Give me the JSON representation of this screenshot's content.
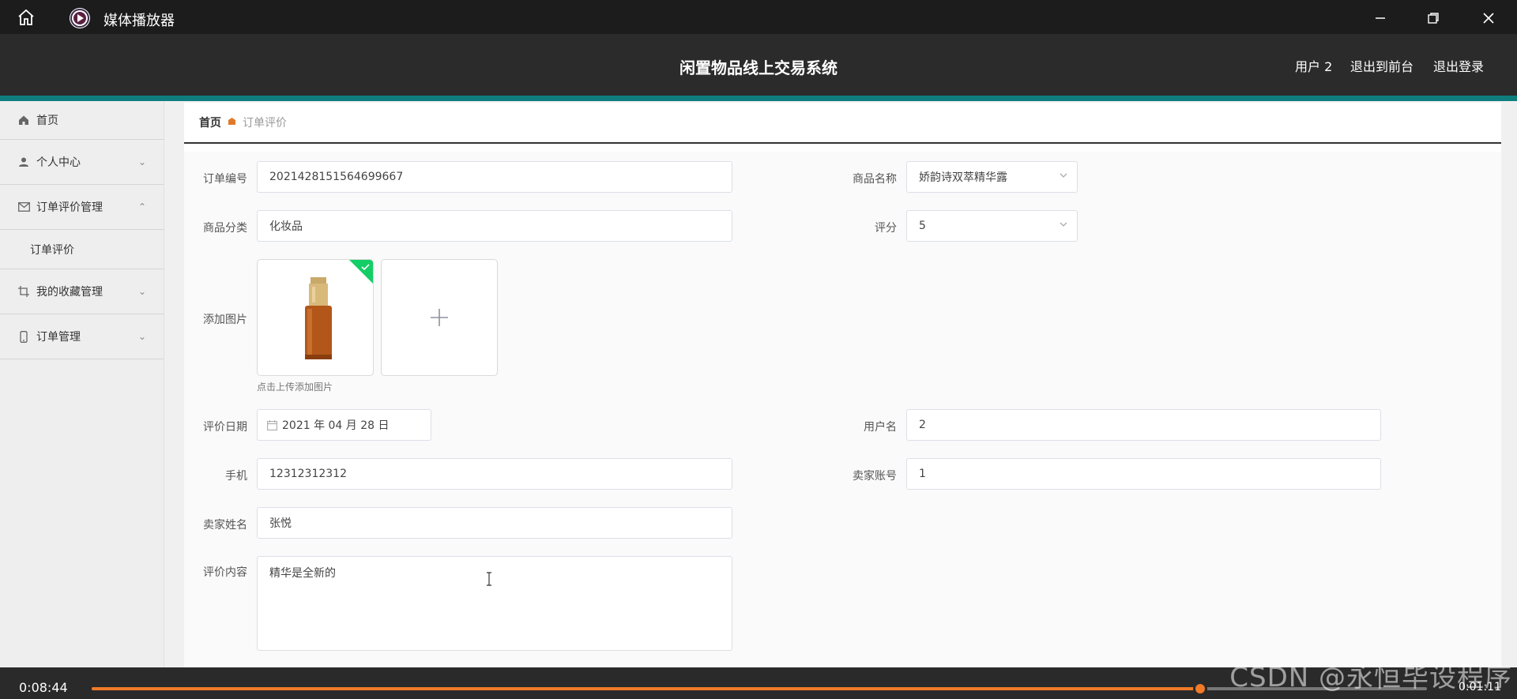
{
  "player": {
    "title": "媒体播放器",
    "time_elapsed": "0:08:44",
    "time_remaining": "0:01:11",
    "progress": 0.83,
    "accent": "#f07a28"
  },
  "app": {
    "title": "闲置物品线上交易系统",
    "user_label": "用户 2",
    "to_front": "退出到前台",
    "logout": "退出登录"
  },
  "sidebar": {
    "items": [
      {
        "label": "首页",
        "icon": "home-icon"
      },
      {
        "label": "个人中心",
        "icon": "user-icon"
      },
      {
        "label": "订单评价管理",
        "icon": "mail-icon"
      },
      {
        "label": "我的收藏管理",
        "icon": "crop-icon"
      },
      {
        "label": "订单管理",
        "icon": "phone-icon"
      }
    ],
    "sub_item": "订单评价"
  },
  "breadcrumb": {
    "home": "首页",
    "current": "订单评价"
  },
  "form": {
    "order_no": {
      "label": "订单编号",
      "value": "2021428151564699667"
    },
    "product_name": {
      "label": "商品名称",
      "value": "娇韵诗双萃精华露"
    },
    "category": {
      "label": "商品分类",
      "value": "化妆品"
    },
    "rating": {
      "label": "评分",
      "value": "5"
    },
    "add_image": {
      "label": "添加图片",
      "tip": "点击上传添加图片"
    },
    "review_date": {
      "label": "评价日期",
      "value": "2021 年 04 月 28 日"
    },
    "username": {
      "label": "用户名",
      "value": "2"
    },
    "phone": {
      "label": "手机",
      "value": "12312312312"
    },
    "seller_account": {
      "label": "卖家账号",
      "value": "1"
    },
    "seller_name": {
      "label": "卖家姓名",
      "value": "张悦"
    },
    "review_content": {
      "label": "评价内容",
      "value": "精华是全新的"
    }
  },
  "watermark": "CSDN @永恒毕设程序"
}
